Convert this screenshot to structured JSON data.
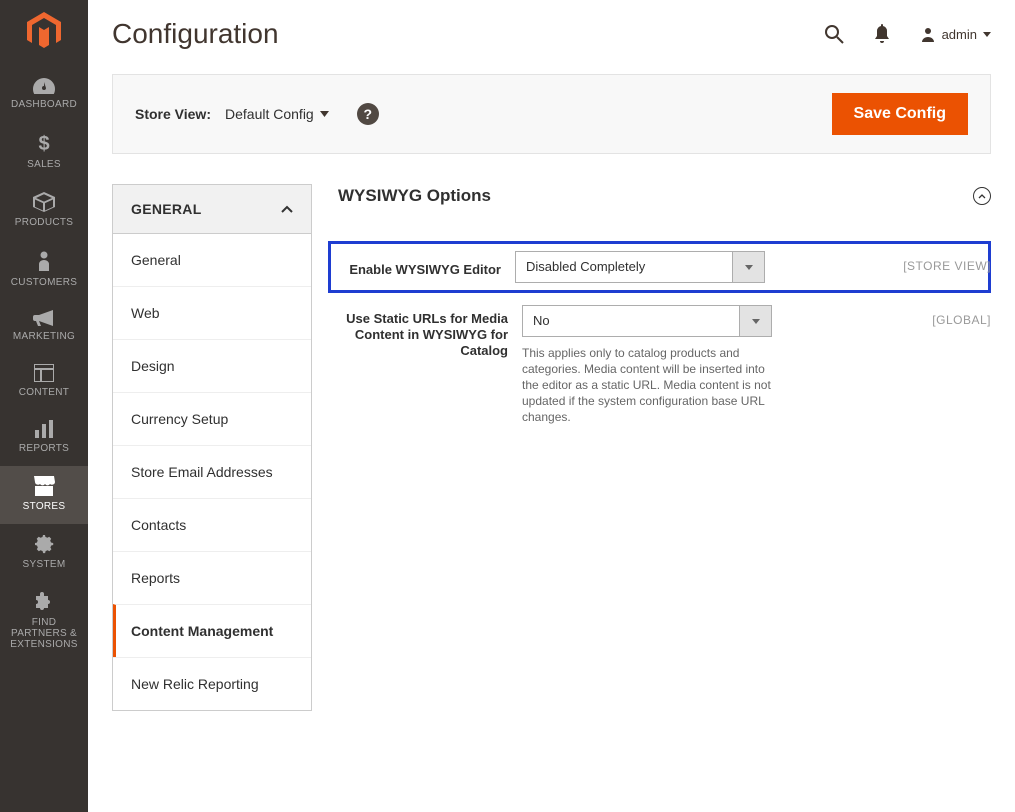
{
  "page_title": "Configuration",
  "user_name": "admin",
  "toolbar": {
    "store_view_label": "Store View:",
    "store_view_value": "Default Config",
    "save_label": "Save Config"
  },
  "nav": [
    {
      "label": "DASHBOARD"
    },
    {
      "label": "SALES"
    },
    {
      "label": "PRODUCTS"
    },
    {
      "label": "CUSTOMERS"
    },
    {
      "label": "MARKETING"
    },
    {
      "label": "CONTENT"
    },
    {
      "label": "REPORTS"
    },
    {
      "label": "STORES"
    },
    {
      "label": "SYSTEM"
    },
    {
      "label": "FIND PARTNERS & EXTENSIONS"
    }
  ],
  "sidepanel": {
    "group": "GENERAL",
    "items": [
      "General",
      "Web",
      "Design",
      "Currency Setup",
      "Store Email Addresses",
      "Contacts",
      "Reports",
      "Content Management",
      "New Relic Reporting"
    ]
  },
  "section": {
    "title": "WYSIWYG Options",
    "fields": {
      "enable": {
        "label": "Enable WYSIWYG Editor",
        "value": "Disabled Completely",
        "scope": "[STORE VIEW]"
      },
      "static_urls": {
        "label": "Use Static URLs for Media Content in WYSIWYG for Catalog",
        "value": "No",
        "scope": "[GLOBAL]",
        "help": "This applies only to catalog products and categories. Media content will be inserted into the editor as a static URL. Media content is not updated if the system configuration base URL changes."
      }
    }
  }
}
